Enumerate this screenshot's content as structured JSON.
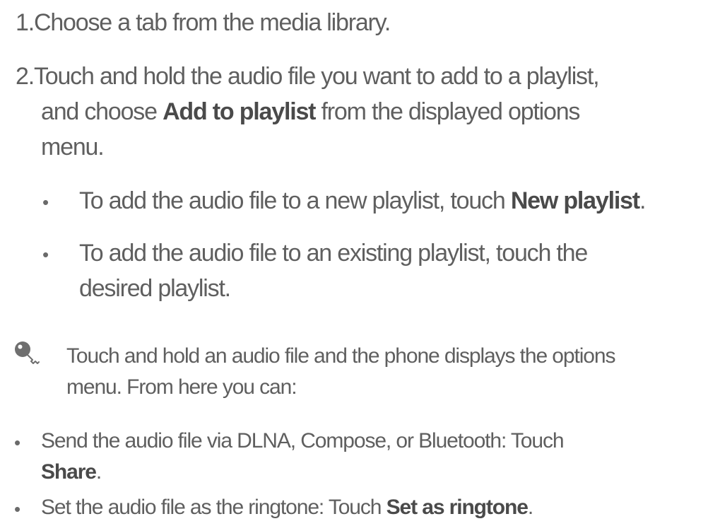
{
  "steps": [
    {
      "number": "1.",
      "text": "Choose a tab from the media library."
    },
    {
      "number": "2.",
      "line1": "Touch and hold the audio file you want to add to a playlist,",
      "line2_pre": "and choose ",
      "line2_bold": "Add to playlist",
      "line2_post": " from the displayed options",
      "line3": "menu."
    }
  ],
  "sub_bullets": [
    {
      "bullet": "•",
      "pre": "To add the audio file to a new playlist, touch ",
      "bold": "New playlist",
      "post": "."
    },
    {
      "bullet": "•",
      "line1": "To add the audio file to an existing playlist, touch the",
      "line2": "desired playlist."
    }
  ],
  "tip": {
    "icon": "key-icon",
    "line1": "Touch and hold an audio file and the phone displays the options",
    "line2": "menu. From here you can:"
  },
  "options": [
    {
      "bullet": "•",
      "line1": "Send the audio file via DLNA, Compose, or Bluetooth: Touch",
      "bold": "Share",
      "post": "."
    },
    {
      "bullet": "•",
      "pre": "Set the audio file as the ringtone: Touch ",
      "bold": "Set as ringtone",
      "post": "."
    }
  ],
  "colors": {
    "text": "#5f5f5f",
    "bold_text": "#4a4a4a",
    "icon": "#6f6f6f"
  }
}
